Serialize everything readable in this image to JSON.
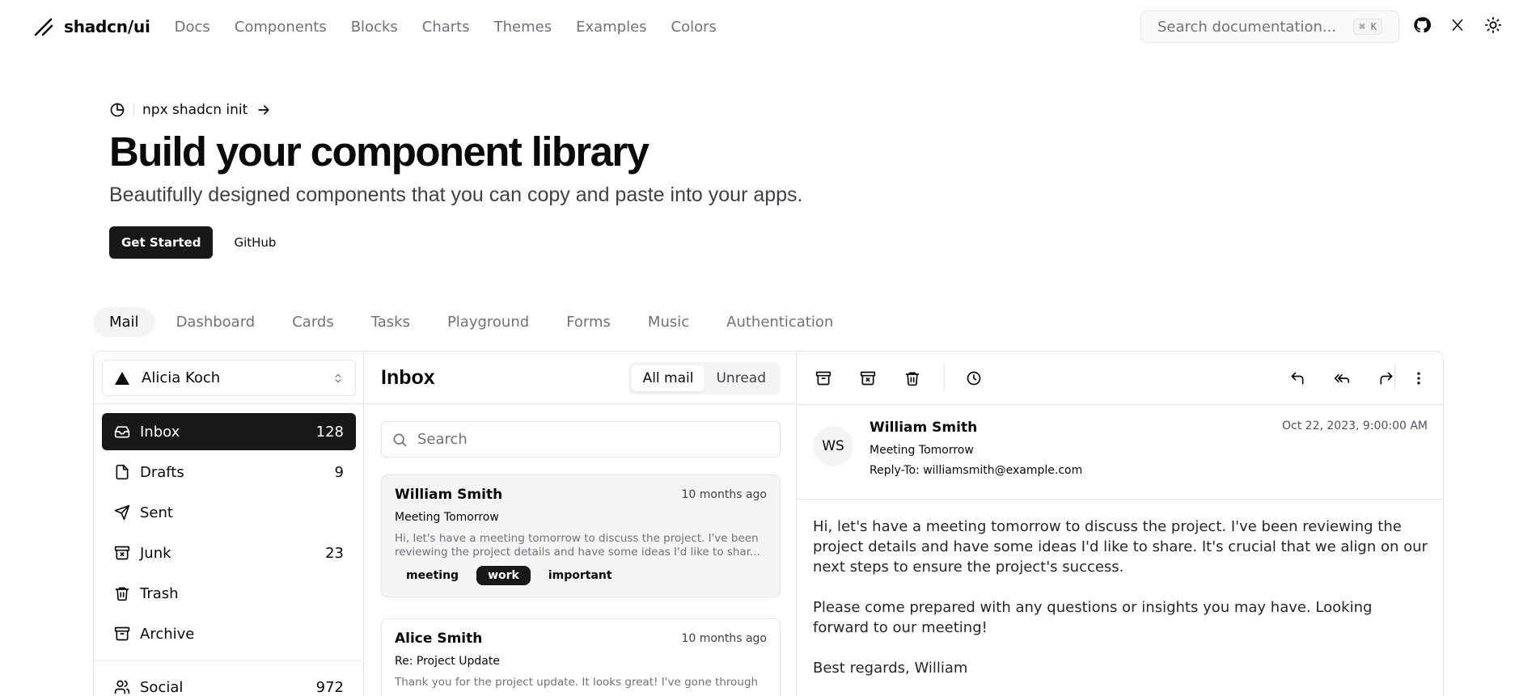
{
  "header": {
    "brand": "shadcn/ui",
    "nav": [
      "Docs",
      "Components",
      "Blocks",
      "Charts",
      "Themes",
      "Examples",
      "Colors"
    ],
    "search_placeholder": "Search documentation...",
    "shortcut": "⌘ K"
  },
  "hero": {
    "announcement": "npx shadcn init",
    "title": "Build your component library",
    "subtitle": "Beautifully designed components that you can copy and paste into your apps.",
    "primary_button": "Get Started",
    "secondary_button": "GitHub"
  },
  "example_tabs": [
    "Mail",
    "Dashboard",
    "Cards",
    "Tasks",
    "Playground",
    "Forms",
    "Music",
    "Authentication"
  ],
  "mail": {
    "account": "Alicia Koch",
    "folders": [
      {
        "label": "Inbox",
        "count": "128",
        "icon": "inbox-icon"
      },
      {
        "label": "Drafts",
        "count": "9",
        "icon": "file-icon"
      },
      {
        "label": "Sent",
        "count": "",
        "icon": "send-icon"
      },
      {
        "label": "Junk",
        "count": "23",
        "icon": "archive-x-icon"
      },
      {
        "label": "Trash",
        "count": "",
        "icon": "trash-icon"
      },
      {
        "label": "Archive",
        "count": "",
        "icon": "archive-icon"
      }
    ],
    "categories": [
      {
        "label": "Social",
        "count": "972",
        "icon": "users-icon"
      }
    ],
    "list_title": "Inbox",
    "filters": [
      "All mail",
      "Unread"
    ],
    "search_placeholder": "Search",
    "messages": [
      {
        "name": "William Smith",
        "time": "10 months ago",
        "subject": "Meeting Tomorrow",
        "preview": "Hi, let's have a meeting tomorrow to discuss the project. I've been reviewing the project details and have some ideas I'd like to shar...",
        "tags": [
          "meeting",
          "work",
          "important"
        ]
      },
      {
        "name": "Alice Smith",
        "time": "10 months ago",
        "subject": "Re: Project Update",
        "preview": "Thank you for the project update. It looks great! I've gone through",
        "tags": []
      }
    ],
    "detail": {
      "initials": "WS",
      "from": "William Smith",
      "subject": "Meeting Tomorrow",
      "reply_to": "Reply-To: williamsmith@example.com",
      "date": "Oct 22, 2023, 9:00:00 AM",
      "body": [
        "Hi, let's have a meeting tomorrow to discuss the project. I've been reviewing the project details and have some ideas I'd like to share. It's crucial that we align on our next steps to ensure the project's success.",
        "Please come prepared with any questions or insights you may have. Looking forward to our meeting!",
        "Best regards, William"
      ]
    }
  }
}
